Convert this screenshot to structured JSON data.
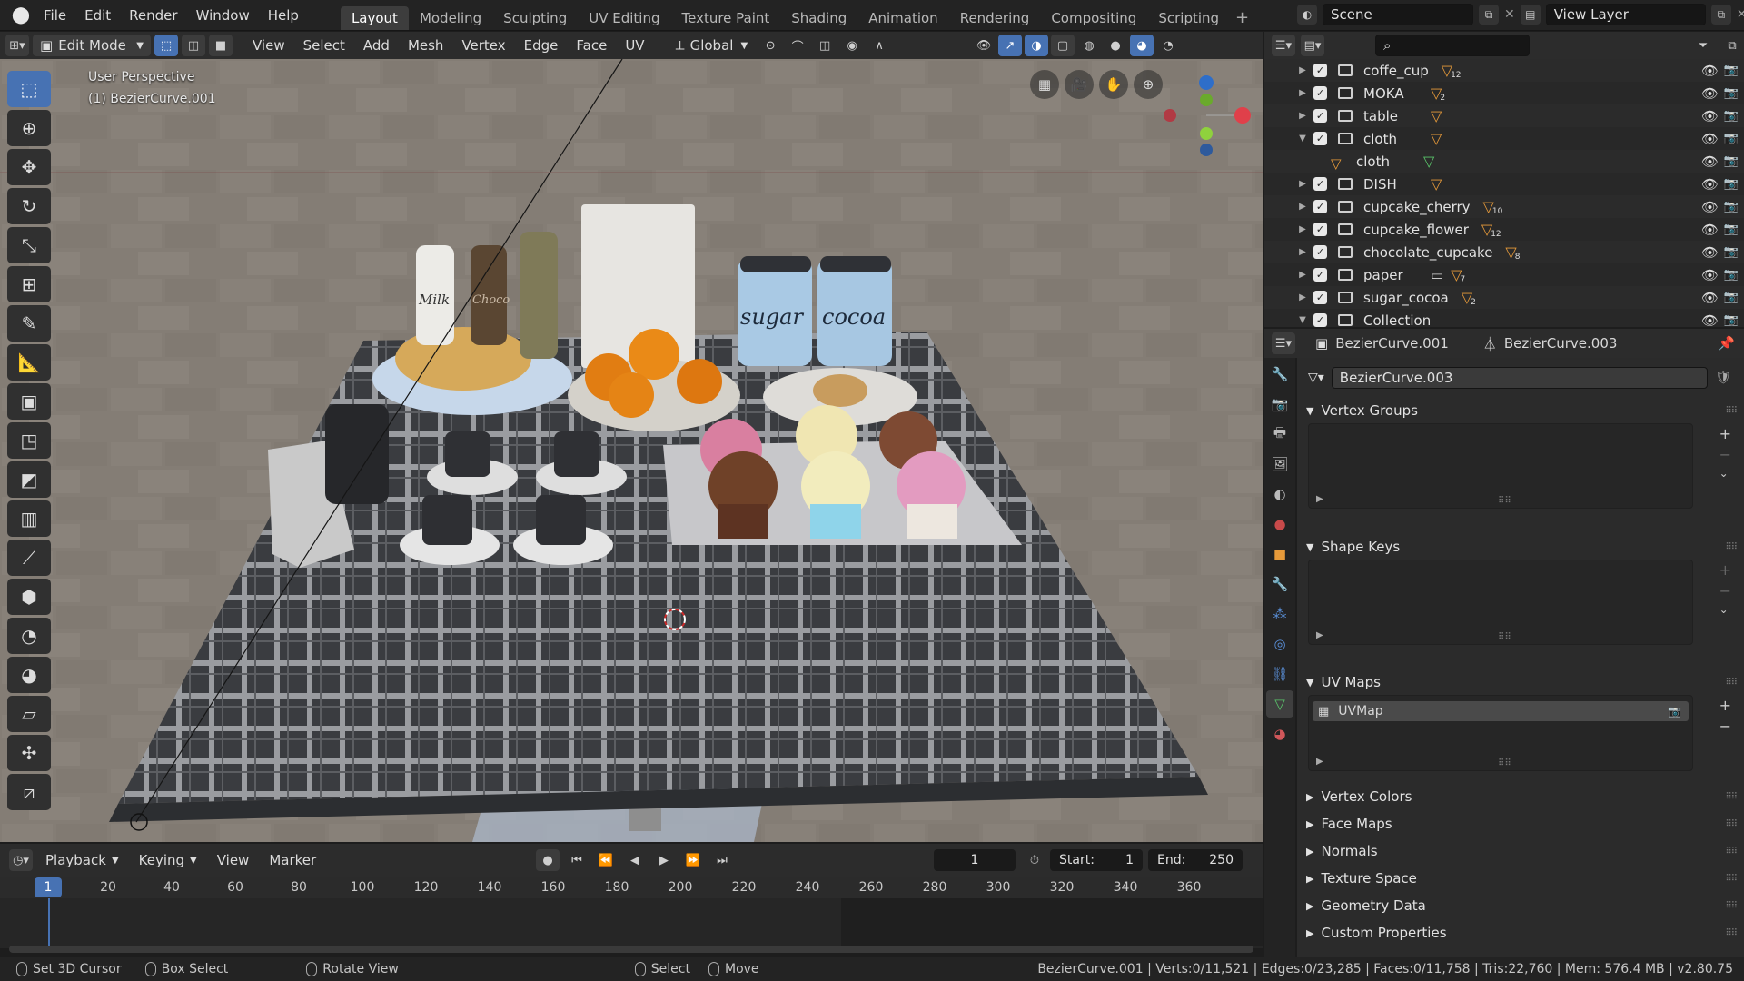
{
  "topbar": {
    "menus": [
      "File",
      "Edit",
      "Render",
      "Window",
      "Help"
    ],
    "workspaces": [
      "Layout",
      "Modeling",
      "Sculpting",
      "UV Editing",
      "Texture Paint",
      "Shading",
      "Animation",
      "Rendering",
      "Compositing",
      "Scripting"
    ],
    "active_workspace": "Layout",
    "scene": "Scene",
    "view_layer": "View Layer"
  },
  "viewport_header": {
    "mode": "Edit Mode",
    "menus": [
      "View",
      "Select",
      "Add",
      "Mesh",
      "Vertex",
      "Edge",
      "Face",
      "UV"
    ],
    "orientation": "Global"
  },
  "viewport": {
    "perspective": "User Perspective",
    "object": "(1) BezierCurve.001",
    "labels": {
      "milk": "Milk",
      "choco": "Choco",
      "sugar": "sugar",
      "cocoa": "cocoa"
    }
  },
  "timeline": {
    "menus": [
      "Playback",
      "Keying",
      "View",
      "Marker"
    ],
    "current_frame": "1",
    "start_label": "Start:",
    "start": "1",
    "end_label": "End:",
    "end": "250",
    "ruler": [
      "1",
      "20",
      "40",
      "60",
      "80",
      "100",
      "120",
      "140",
      "160",
      "180",
      "200",
      "220",
      "240",
      "260",
      "280",
      "300",
      "320",
      "340",
      "360"
    ]
  },
  "statusbar": {
    "items": [
      "Set 3D Cursor",
      "Box Select",
      "Rotate View",
      "Select",
      "Move"
    ],
    "info": "BezierCurve.001 | Verts:0/11,521 | Edges:0/23,285 | Faces:0/11,758 | Tris:22,760 | Mem: 576.4 MB | v2.80.75"
  },
  "outliner": {
    "rows": [
      {
        "name": "coffe_cup",
        "badge": "12",
        "expanded": false
      },
      {
        "name": "MOKA",
        "badge": "2",
        "expanded": false
      },
      {
        "name": "table",
        "badge": "",
        "expanded": false
      },
      {
        "name": "cloth",
        "badge": "",
        "expanded": true
      },
      {
        "name": "cloth",
        "badge": "",
        "child": true
      },
      {
        "name": "DISH",
        "badge": "",
        "expanded": false
      },
      {
        "name": "cupcake_cherry",
        "badge": "10",
        "expanded": false
      },
      {
        "name": "cupcake_flower",
        "badge": "12",
        "expanded": false
      },
      {
        "name": "chocolate_cupcake",
        "badge": "8",
        "expanded": false
      },
      {
        "name": "paper",
        "badge": "7",
        "expanded": false
      },
      {
        "name": "sugar_cocoa",
        "badge": "2",
        "expanded": false
      },
      {
        "name": "Collection",
        "badge": "",
        "expanded": true
      }
    ]
  },
  "properties": {
    "breadcrumb_object": "BezierCurve.001",
    "breadcrumb_data": "BezierCurve.003",
    "data_name": "BezierCurve.003",
    "panels": {
      "vertex_groups": "Vertex Groups",
      "shape_keys": "Shape Keys",
      "uv_maps": "UV Maps",
      "uv_map_item": "UVMap"
    },
    "collapsed_panels": [
      "Vertex Colors",
      "Face Maps",
      "Normals",
      "Texture Space",
      "Geometry Data",
      "Custom Properties"
    ]
  }
}
